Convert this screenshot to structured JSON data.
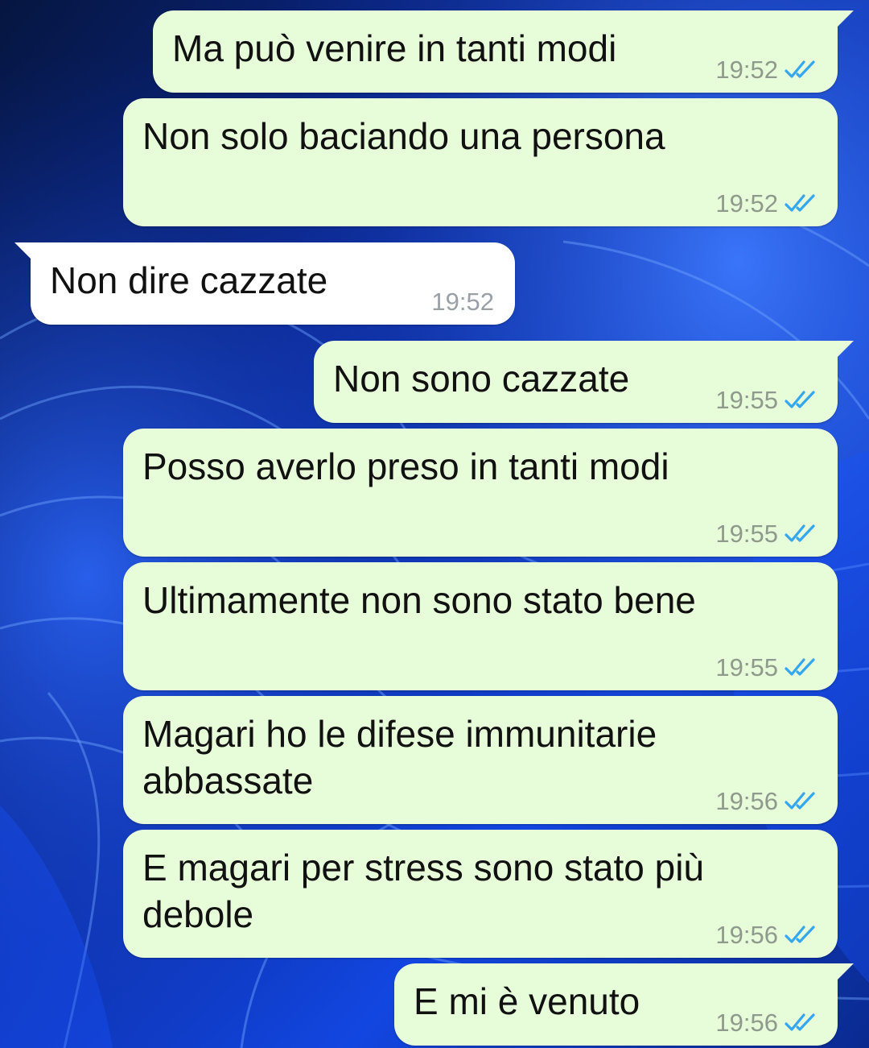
{
  "theme": {
    "outgoing_bubble": "#e7fcd9",
    "incoming_bubble": "#ffffff",
    "read_tick_color": "#34a7f0"
  },
  "status_icon": "double-check-read-icon",
  "messages": [
    {
      "dir": "out",
      "text": "Ma può venire in tanti modi",
      "time": "19:52",
      "tail": true
    },
    {
      "dir": "out",
      "text": "Non solo baciando una persona",
      "time": "19:52",
      "tail": false
    },
    {
      "dir": "in",
      "text": "Non dire cazzate",
      "time": "19:52",
      "tail": true
    },
    {
      "dir": "out",
      "text": "Non sono cazzate",
      "time": "19:55",
      "tail": true
    },
    {
      "dir": "out",
      "text": "Posso averlo preso in tanti modi",
      "time": "19:55",
      "tail": false
    },
    {
      "dir": "out",
      "text": "Ultimamente non sono stato bene",
      "time": "19:55",
      "tail": false
    },
    {
      "dir": "out",
      "text": "Magari ho le difese immunitarie\nabbassate",
      "time": "19:56",
      "tail": false
    },
    {
      "dir": "out",
      "text": "E magari per stress sono stato più\ndebole",
      "time": "19:56",
      "tail": false
    },
    {
      "dir": "out",
      "text": "E mi è venuto",
      "time": "19:56",
      "tail": true
    }
  ]
}
